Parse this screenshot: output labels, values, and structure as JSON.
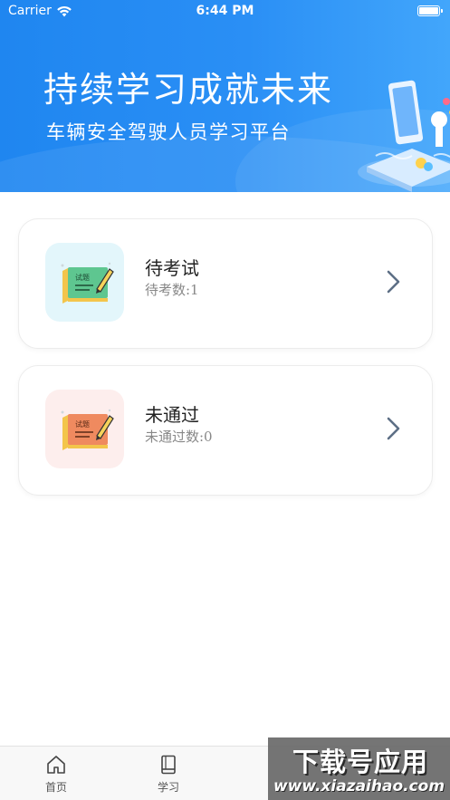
{
  "status_bar": {
    "carrier": "Carrier",
    "time": "6:44 PM"
  },
  "banner": {
    "title": "持续学习成就未来",
    "subtitle": "车辆安全驾驶人员学习平台"
  },
  "cards": [
    {
      "title": "待考试",
      "subtitle": "待考数:1",
      "thumb_text": "试题",
      "thumb_color": "#e3f6fb",
      "icon": "exam-paper-icon",
      "accent": "#52c48a"
    },
    {
      "title": "未通过",
      "subtitle": "未通过数:0",
      "thumb_text": "试题",
      "thumb_color": "#fdeeed",
      "icon": "exam-paper-icon",
      "accent": "#ef8a5f"
    }
  ],
  "tabbar": {
    "items": [
      {
        "label": "首页",
        "icon": "home-icon"
      },
      {
        "label": "学习",
        "icon": "book-icon"
      }
    ]
  },
  "watermark": {
    "big": "下载号应用",
    "small": "www.xiazaihao.com"
  },
  "colors": {
    "primary": "#2a8ff5",
    "card_border": "#ececec",
    "chevron": "#5d6f85"
  }
}
